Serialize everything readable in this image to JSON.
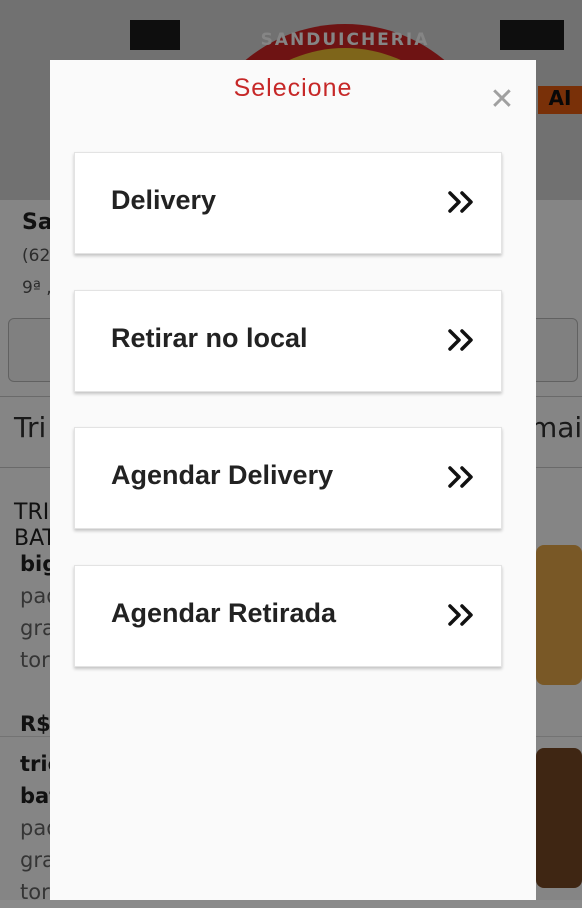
{
  "background": {
    "banner_text": "SANDUICHERIA",
    "banner_badge": "AI",
    "store_name": "Sa",
    "store_phone": "(62",
    "store_addr": "9ª ,",
    "tab_left": "Tri",
    "tab_right": "mais",
    "category_title": "TRI BAT",
    "items": [
      {
        "name": "big",
        "lines": [
          "pad",
          "gra",
          "tor"
        ],
        "price": "R$"
      },
      {
        "name": "tric bat",
        "lines": [
          "pad",
          "gra",
          "tor"
        ]
      }
    ]
  },
  "modal": {
    "title": "Selecione",
    "close_icon": "close-icon",
    "options": [
      {
        "label": "Delivery",
        "icon": "double-chevron-right-icon"
      },
      {
        "label": "Retirar no local",
        "icon": "double-chevron-right-icon"
      },
      {
        "label": "Agendar Delivery",
        "icon": "double-chevron-right-icon"
      },
      {
        "label": "Agendar Retirada",
        "icon": "double-chevron-right-icon"
      }
    ]
  },
  "colors": {
    "title": "#c62828",
    "overlay": "rgba(0,0,0,0.48)"
  }
}
